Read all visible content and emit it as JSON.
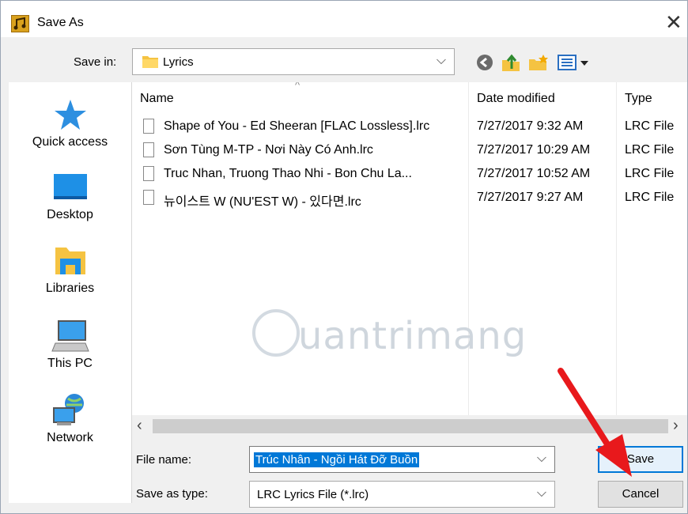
{
  "window": {
    "title": "Save As",
    "close_glyph": "✕"
  },
  "save_in": {
    "label": "Save in:",
    "folder": "Lyrics"
  },
  "places": [
    {
      "label": "Quick access",
      "icon": "quick-access-star-icon"
    },
    {
      "label": "Desktop",
      "icon": "desktop-icon"
    },
    {
      "label": "Libraries",
      "icon": "libraries-icon"
    },
    {
      "label": "This PC",
      "icon": "this-pc-icon"
    },
    {
      "label": "Network",
      "icon": "network-icon"
    }
  ],
  "columns": {
    "name": "Name",
    "date": "Date modified",
    "type": "Type"
  },
  "files": [
    {
      "name": "Shape of You - Ed Sheeran [FLAC Lossless].lrc",
      "date": "7/27/2017 9:32 AM",
      "type": "LRC File"
    },
    {
      "name": "Sơn Tùng M-TP - Nơi Này Có Anh.lrc",
      "date": "7/27/2017 10:29 AM",
      "type": "LRC File"
    },
    {
      "name": "Truc Nhan, Truong Thao Nhi - Bon Chu La...",
      "date": "7/27/2017 10:52 AM",
      "type": "LRC File"
    },
    {
      "name": "뉴이스트 W (NU'EST W) - 있다면.lrc",
      "date": "7/27/2017 9:27 AM",
      "type": "LRC File"
    }
  ],
  "file_name": {
    "label": "File name:",
    "value": "Trúc Nhân - Ngồi Hát Đỡ Buồn"
  },
  "save_as_type": {
    "label": "Save as type:",
    "value": "LRC Lyrics File (*.lrc)"
  },
  "buttons": {
    "save": "Save",
    "cancel": "Cancel"
  },
  "watermark": {
    "text": "uantrimang"
  },
  "colors": {
    "selection": "#0078d7",
    "accent_arrow": "#e8191c",
    "folder": "#f5c342"
  }
}
